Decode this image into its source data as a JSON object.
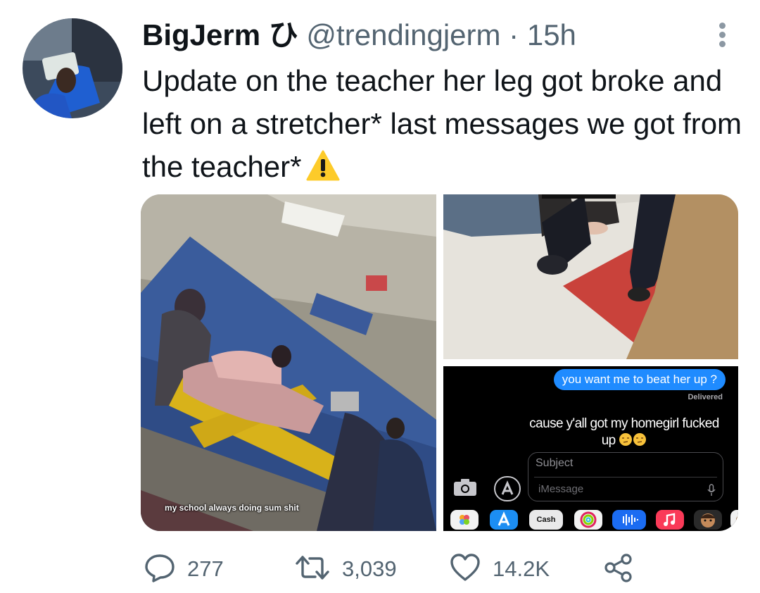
{
  "tweet": {
    "display_name": "BigJerm",
    "name_symbol": "ひ",
    "handle": "@trendingjerm",
    "separator": "·",
    "time": "15h",
    "text": "Update on the teacher her leg got broke and left on a stretcher* last messages we got from the teacher*",
    "text_emoji": "warning-icon"
  },
  "media": {
    "left_caption": "my school always doing sum shit",
    "messages": {
      "outgoing": "you want me to beat her up ?",
      "status": "Delivered",
      "incoming": "cause y'all got my homegirl fucked up",
      "subject_placeholder": "Subject",
      "message_placeholder": "iMessage",
      "tray_cash_label": "Cash"
    }
  },
  "actions": {
    "replies": "277",
    "retweets": "3,039",
    "likes": "14.2K"
  },
  "colors": {
    "text": "#0f1419",
    "muted": "#536471",
    "imessage_blue": "#1f8bff"
  }
}
